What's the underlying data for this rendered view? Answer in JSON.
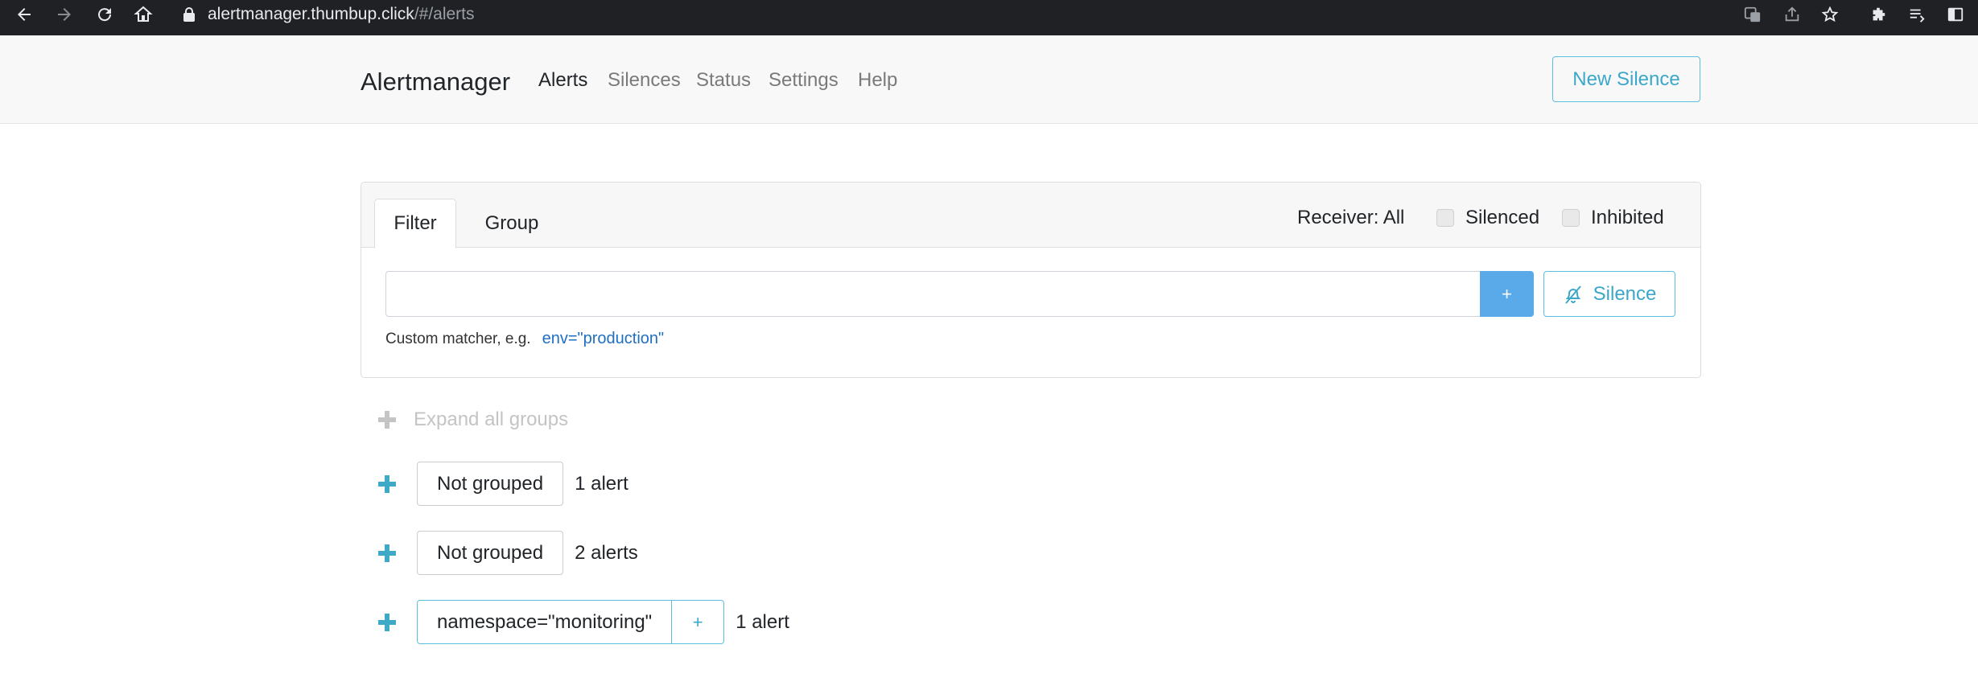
{
  "browser": {
    "url_host": "alertmanager.thumbup.click",
    "url_path": "/#/alerts"
  },
  "navbar": {
    "brand": "Alertmanager",
    "links": [
      "Alerts",
      "Silences",
      "Status",
      "Settings",
      "Help"
    ],
    "active_link": "Alerts",
    "new_silence_label": "New Silence"
  },
  "filter_card": {
    "tabs": [
      "Filter",
      "Group"
    ],
    "active_tab": "Filter",
    "receiver_label": "Receiver: All",
    "silenced_label": "Silenced",
    "inhibited_label": "Inhibited",
    "input_value": "",
    "plus_label": "+",
    "silence_label": "Silence",
    "hint_text": "Custom matcher, e.g.",
    "hint_example": "env=\"production\""
  },
  "groups": {
    "expand_all_label": "Expand all groups",
    "items": [
      {
        "label": "Not grouped",
        "count": "1 alert"
      },
      {
        "label": "Not grouped",
        "count": "2 alerts"
      },
      {
        "label": "namespace=\"monitoring\"",
        "add_label": "+",
        "count": "1 alert"
      }
    ]
  },
  "colors": {
    "accent": "#5bc0de",
    "primary_button": "#5aaaea",
    "link": "#1f6fc2"
  }
}
